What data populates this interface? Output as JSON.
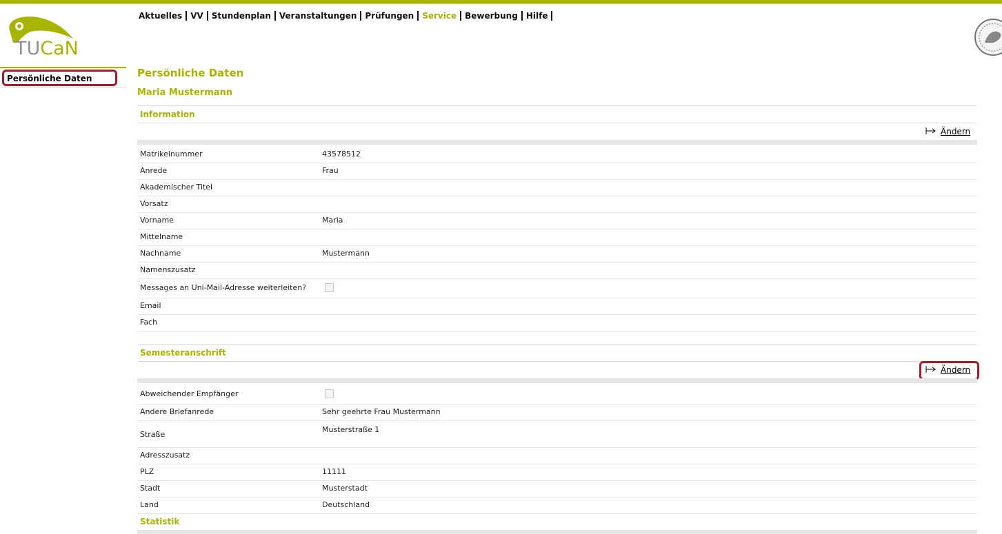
{
  "brand": {
    "logo_tu": "TU",
    "logo_can": "CaN",
    "accent": "#a8b400",
    "highlight": "#b0182a"
  },
  "mainnav": [
    {
      "label": "Aktuelles",
      "active": false
    },
    {
      "label": "VV",
      "active": false
    },
    {
      "label": "Stundenplan",
      "active": false
    },
    {
      "label": "Veranstaltungen",
      "active": false
    },
    {
      "label": "Prüfungen",
      "active": false
    },
    {
      "label": "Service",
      "active": true
    },
    {
      "label": "Bewerbung",
      "active": false
    },
    {
      "label": "Hilfe",
      "active": false
    }
  ],
  "sidebar": {
    "items": [
      {
        "label": "Persönliche Daten"
      }
    ]
  },
  "page": {
    "title": "Persönliche Daten",
    "person": "Maria Mustermann"
  },
  "information": {
    "title": "Information",
    "edit_label": "Ändern",
    "rows": [
      {
        "label": "Matrikelnummer",
        "value": "43578512"
      },
      {
        "label": "Anrede",
        "value": "Frau"
      },
      {
        "label": "Akademischer Titel",
        "value": ""
      },
      {
        "label": "Vorsatz",
        "value": ""
      },
      {
        "label": "Vorname",
        "value": "Maria"
      },
      {
        "label": "Mittelname",
        "value": ""
      },
      {
        "label": "Nachname",
        "value": "Mustermann"
      },
      {
        "label": "Namenszusatz",
        "value": ""
      },
      {
        "label": "Messages an Uni-Mail-Adresse weiterleiten?",
        "checkbox": false
      },
      {
        "label": "Email",
        "value": ""
      },
      {
        "label": "Fach",
        "value": ""
      }
    ]
  },
  "semesteranschrift": {
    "title": "Semesteranschrift",
    "edit_label": "Ändern",
    "rows": [
      {
        "label": "Abweichender Empfänger",
        "checkbox": false
      },
      {
        "label": "Andere Briefanrede",
        "value": "Sehr geehrte Frau Mustermann"
      },
      {
        "label": "Straße",
        "value": "Musterstraße 1"
      },
      {
        "label": "Adresszusatz",
        "value": ""
      },
      {
        "label": "PLZ",
        "value": "11111"
      },
      {
        "label": "Stadt",
        "value": "Musterstadt"
      },
      {
        "label": "Land",
        "value": "Deutschland"
      }
    ]
  },
  "statistik": {
    "title": "Statistik"
  }
}
